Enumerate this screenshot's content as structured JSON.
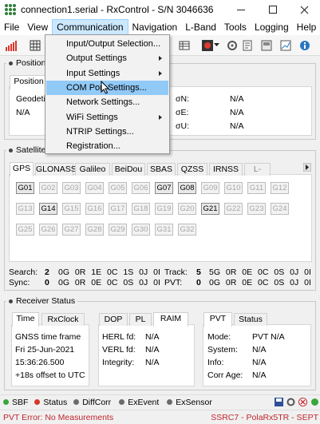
{
  "window": {
    "title": "connection1.serial - RxControl - S/N 3046636"
  },
  "menubar": [
    "File",
    "View",
    "Communication",
    "Navigation",
    "L-Band",
    "Tools",
    "Logging",
    "Help"
  ],
  "dropdown": {
    "items": [
      {
        "label": "Input/Output Selection...",
        "submenu": false
      },
      {
        "label": "Output Settings",
        "submenu": true
      },
      {
        "label": "Input Settings",
        "submenu": true
      },
      {
        "label": "COM Port Settings...",
        "submenu": false
      },
      {
        "label": "Network Settings...",
        "submenu": false
      },
      {
        "label": "WiFi Settings",
        "submenu": true
      },
      {
        "label": "NTRIP Settings...",
        "submenu": false
      },
      {
        "label": "Registration...",
        "submenu": false
      }
    ],
    "highlighted": 3
  },
  "position": {
    "group_label": "Position I",
    "tab": "Position",
    "geodetic_label": "Geodetic",
    "geodetic_value": "N/A",
    "sigmas": [
      {
        "label": "σN:",
        "value": "N/A"
      },
      {
        "label": "σE:",
        "value": "N/A"
      },
      {
        "label": "σU:",
        "value": "N/A"
      }
    ]
  },
  "satellites": {
    "group_label": "Satellite S",
    "tabs": [
      "GPS",
      "GLONASS",
      "Galileo",
      "BeiDou",
      "SBAS",
      "QZSS",
      "IRNSS",
      "L-Band"
    ],
    "selected_tab": "GPS",
    "sats": [
      "G01",
      "G02",
      "G03",
      "G04",
      "G05",
      "G06",
      "G07",
      "G08",
      "G09",
      "G10",
      "G11",
      "G12",
      "G13",
      "G14",
      "G15",
      "G16",
      "G17",
      "G18",
      "G19",
      "G20",
      "G21",
      "G22",
      "G23",
      "G24",
      "G25",
      "G26",
      "G27",
      "G28",
      "G29",
      "G30",
      "G31",
      "G32"
    ],
    "active": [
      "G01",
      "G07",
      "G08",
      "G14",
      "G21"
    ],
    "search_label": "Search:",
    "search_count": "2",
    "search_vals": "0G 0R 1E 0C 1S 0J 0I",
    "sync_label": "Sync:",
    "sync_count": "0",
    "sync_vals": "0G 0R 0E 0C 0S 0J 0I",
    "track_label": "Track:",
    "track_count": "5",
    "track_vals": "5G 0R 0E 0C 0S 0J 0I",
    "pvt_label": "PVT:",
    "pvt_count": "0",
    "pvt_vals": "0G 0R 0E 0C 0S 0J 0I"
  },
  "receiver": {
    "group_label": "Receiver Status",
    "time_tabs": [
      "Time",
      "RxClock"
    ],
    "time_lines": [
      "GNSS time frame",
      "Fri 25-Jun-2021",
      "15:36:26.500",
      "+18s offset to UTC"
    ],
    "dop_tabs": [
      "DOP",
      "PL",
      "RAIM"
    ],
    "raim_rows": [
      {
        "label": "HERL fd:",
        "value": "N/A"
      },
      {
        "label": "VERL fd:",
        "value": "N/A"
      },
      {
        "label": "Integrity:",
        "value": "N/A"
      }
    ],
    "pvt_tabs": [
      "PVT",
      "Status"
    ],
    "pvt_rows": [
      {
        "label": "Mode:",
        "value": "PVT N/A"
      },
      {
        "label": "System:",
        "value": "N/A"
      },
      {
        "label": "Info:",
        "value": "N/A"
      },
      {
        "label": "Corr Age:",
        "value": "N/A"
      }
    ]
  },
  "statusbar": {
    "items": [
      {
        "label": "SBF",
        "color": "#3aa53a"
      },
      {
        "label": "Status",
        "color": "#d9362b"
      },
      {
        "label": "DiffCorr",
        "color": "#6b6b6b"
      },
      {
        "label": "ExEvent",
        "color": "#6b6b6b"
      },
      {
        "label": "ExSensor",
        "color": "#6b6b6b"
      }
    ]
  },
  "message": {
    "left": "PVT Error: No Measurements",
    "right": "SSRC7 - PolaRx5TR - SEPT",
    "color": "#c0262d"
  }
}
